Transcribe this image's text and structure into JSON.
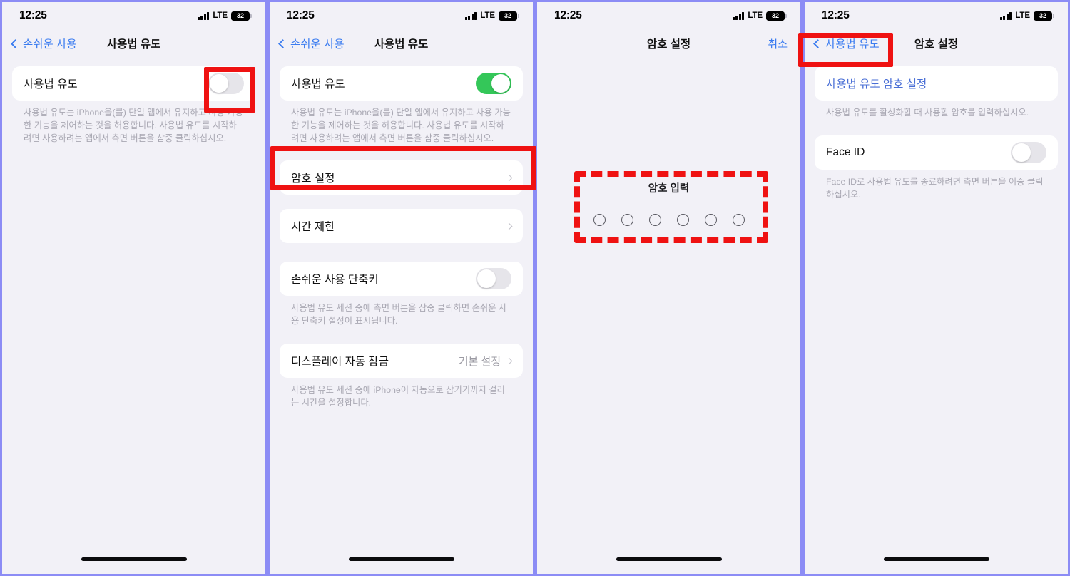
{
  "status_bar": {
    "time": "12:25",
    "network": "LTE",
    "battery_level": "32",
    "signal_icon": "cellular-bars-icon"
  },
  "panels": [
    {
      "id": "panel-guided-access-off",
      "nav": {
        "back_label": "손쉬운 사용",
        "title": "사용법 유도",
        "right_label": ""
      },
      "rows": [
        {
          "label": "사용법 유도",
          "type": "toggle",
          "state": "off"
        }
      ],
      "desc": "사용법 유도는 iPhone을(를) 단일 앱에서 유지하고 사용 가능한 기능을 제어하는 것을 허용합니다. 사용법 유도를 시작하려면 사용하려는 앱에서 측면 버튼을 삼중 클릭하십시오."
    },
    {
      "id": "panel-guided-access-on",
      "nav": {
        "back_label": "손쉬운 사용",
        "title": "사용법 유도",
        "right_label": ""
      },
      "rows": [
        {
          "label": "사용법 유도",
          "type": "toggle",
          "state": "on"
        },
        {
          "label": "암호 설정",
          "type": "link",
          "value": ""
        },
        {
          "label": "시간 제한",
          "type": "link",
          "value": ""
        },
        {
          "label": "손쉬운 사용 단축키",
          "type": "toggle",
          "state": "off"
        },
        {
          "label": "디스플레이 자동 잠금",
          "type": "link",
          "value": "기본 설정"
        }
      ],
      "desc_main": "사용법 유도는 iPhone을(를) 단일 앱에서 유지하고 사용 가능한 기능을 제어하는 것을 허용합니다. 사용법 유도를 시작하려면 사용하려는 앱에서 측면 버튼을 삼중 클릭하십시오.",
      "desc_shortcut": "사용법 유도 세션 중에 측면 버튼을 삼중 클릭하면 손쉬운 사용 단축키 설정이 표시됩니다.",
      "desc_autolock": "사용법 유도 세션 중에 iPhone이 자동으로 잠기기까지 걸리는 시간을 설정합니다."
    },
    {
      "id": "panel-passcode-entry",
      "nav": {
        "back_label": "",
        "title": "암호 설정",
        "right_label": "취소"
      },
      "passcode": {
        "prompt": "암호 입력",
        "digit_count": 6,
        "filled": 0
      }
    },
    {
      "id": "panel-passcode-settings",
      "nav": {
        "back_label": "사용법 유도",
        "title": "암호 설정",
        "right_label": ""
      },
      "rows": [
        {
          "label": "사용법 유도 암호 설정",
          "type": "link-blue"
        },
        {
          "label": "Face ID",
          "type": "toggle",
          "state": "off"
        }
      ],
      "desc_passcode": "사용법 유도를 활성화할 때 사용할 암호를 입력하십시오.",
      "desc_faceid": "Face ID로 사용법 유도를 종료하려면 측면 버튼을 이중 클릭하십시오."
    }
  ],
  "annotations": {
    "accent_color": "#ef1212",
    "items": [
      {
        "name": "highlight-guided-access-toggle",
        "style": "solid"
      },
      {
        "name": "highlight-passcode-settings-row",
        "style": "solid"
      },
      {
        "name": "highlight-passcode-entry-area",
        "style": "dashed"
      },
      {
        "name": "highlight-back-to-guided-access",
        "style": "solid"
      }
    ]
  }
}
